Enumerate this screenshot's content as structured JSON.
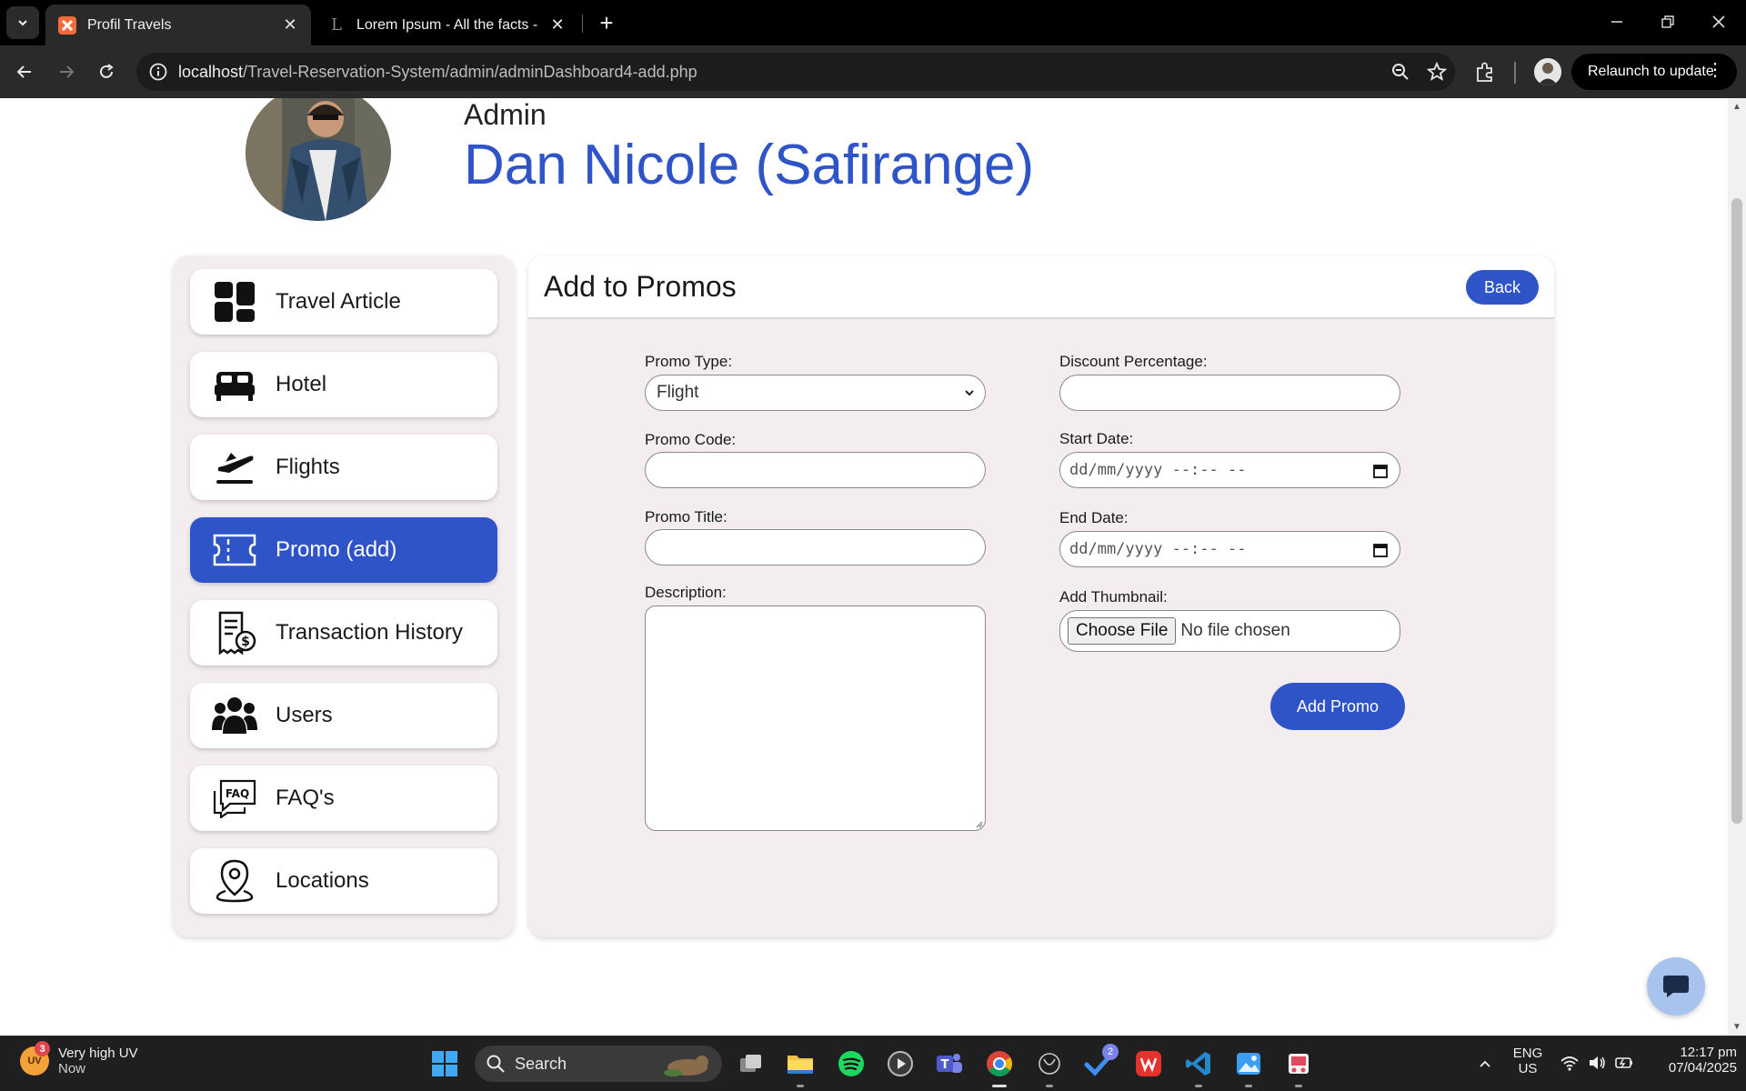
{
  "browser": {
    "tabs": [
      {
        "title": "Profil Travels",
        "active": true,
        "favicon_color": "#f26b3a"
      },
      {
        "title": "Lorem Ipsum - All the facts - Lip",
        "active": false
      }
    ],
    "url_host": "localhost",
    "url_path": "/Travel-Reservation-System/admin/adminDashboard4-add.php",
    "relaunch_label": "Relaunch to update"
  },
  "header": {
    "role": "Admin",
    "name": "Dan Nicole (Safirange)"
  },
  "sidebar": {
    "items": [
      {
        "label": "Travel Article",
        "icon": "dashboard-icon"
      },
      {
        "label": "Hotel",
        "icon": "bed-icon"
      },
      {
        "label": "Flights",
        "icon": "plane-departure-icon"
      },
      {
        "label": "Promo (add)",
        "icon": "ticket-icon",
        "active": true
      },
      {
        "label": "Transaction History",
        "icon": "receipt-icon"
      },
      {
        "label": "Users",
        "icon": "users-icon"
      },
      {
        "label": "FAQ's",
        "icon": "faq-icon"
      },
      {
        "label": "Locations",
        "icon": "location-pin-icon"
      }
    ]
  },
  "panel": {
    "title": "Add to Promos",
    "back_label": "Back",
    "form": {
      "promo_type_label": "Promo Type:",
      "promo_type_value": "Flight",
      "promo_code_label": "Promo Code:",
      "promo_code_value": "",
      "promo_title_label": "Promo Title:",
      "promo_title_value": "",
      "description_label": "Description:",
      "description_value": "",
      "discount_label": "Discount Percentage:",
      "discount_value": "",
      "start_date_label": "Start Date:",
      "start_date_placeholder": "dd/mm/yyyy --:-- --",
      "end_date_label": "End Date:",
      "end_date_placeholder": "dd/mm/yyyy --:-- --",
      "thumbnail_label": "Add Thumbnail:",
      "choose_file_label": "Choose File",
      "file_status": "No file chosen",
      "submit_label": "Add Promo"
    }
  },
  "taskbar": {
    "weather_main": "Very high UV",
    "weather_sub": "Now",
    "weather_badge": "3",
    "weather_icon_text": "UV",
    "search_label": "Search",
    "teams_badge": "2",
    "lang_line1": "ENG",
    "lang_line2": "US",
    "time": "12:17 pm",
    "date": "07/04/2025"
  },
  "colors": {
    "accent": "#2f54c7",
    "panel_bg": "#f3edf0",
    "chrome_bg": "#000000"
  }
}
